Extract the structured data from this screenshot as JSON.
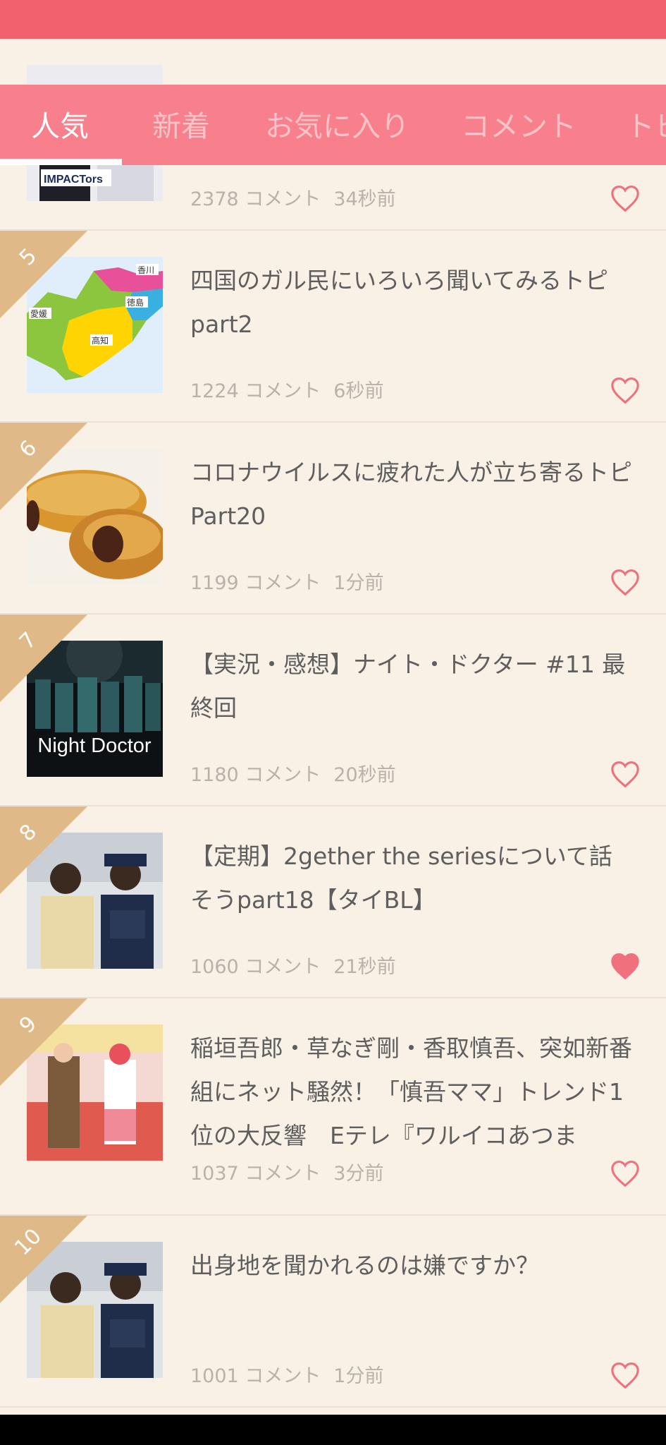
{
  "colors": {
    "status_bar": "#f0606d",
    "tab_bar": "#f7808c",
    "rank_ribbon": "#e0b988",
    "heart": "#f0707d",
    "background": "#f9f0e6"
  },
  "tabs": [
    {
      "label": "人気",
      "active": true
    },
    {
      "label": "新着",
      "active": false
    },
    {
      "label": "お気に入り",
      "active": false
    },
    {
      "label": "コメント",
      "active": false
    },
    {
      "label": "トピ",
      "active": false
    }
  ],
  "topics": [
    {
      "rank": "",
      "title": "",
      "comments": "2378 コメント",
      "time": "34秒前",
      "favorited": false,
      "thumb_caption": "IMPACTors"
    },
    {
      "rank": "5",
      "title": "四国のガル民にいろいろ聞いてみるトピpart2",
      "comments": "1224 コメント",
      "time": "6秒前",
      "favorited": false,
      "map_labels": [
        "香川",
        "徳島",
        "愛媛",
        "高知"
      ]
    },
    {
      "rank": "6",
      "title": "コロナウイルスに疲れた人が立ち寄るトピPart20",
      "comments": "1199 コメント",
      "time": "1分前",
      "favorited": false
    },
    {
      "rank": "7",
      "title": "【実況・感想】ナイト・ドクター #11 最終回",
      "comments": "1180 コメント",
      "time": "20秒前",
      "favorited": false,
      "thumb_caption": "Night Doctor"
    },
    {
      "rank": "8",
      "title": "【定期】2gether the seriesについて話そうpart18【タイBL】",
      "comments": "1060 コメント",
      "time": "21秒前",
      "favorited": true
    },
    {
      "rank": "9",
      "title": "稲垣吾郎・草なぎ剛・香取慎吾、突如新番組にネット騒然！「慎吾ママ」トレンド1位の大反響　Eテレ『ワルイコあつま",
      "comments": "1037 コメント",
      "time": "3分前",
      "favorited": false
    },
    {
      "rank": "10",
      "title": "出身地を聞かれるのは嫌ですか？",
      "comments": "1001 コメント",
      "time": "1分前",
      "favorited": false
    }
  ]
}
